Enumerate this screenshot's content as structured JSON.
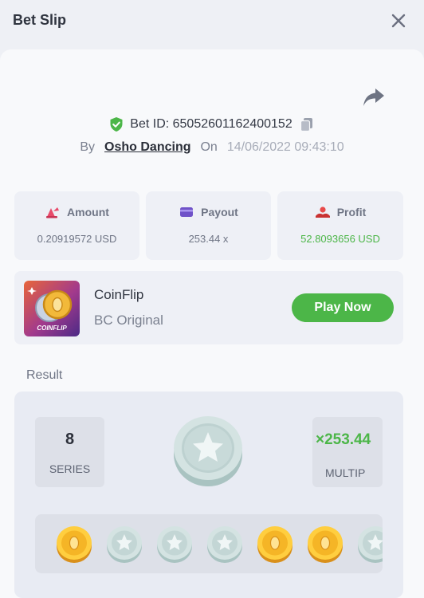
{
  "header": {
    "title": "Bet Slip"
  },
  "bet": {
    "id_label": "Bet ID: 65052601162400152",
    "by_label": "By",
    "user": "Osho Dancing",
    "on_label": "On",
    "date": "14/06/2022 09:43:10"
  },
  "stats": [
    {
      "label": "Amount",
      "value": "0.20919572 USD",
      "icon": "amount-icon"
    },
    {
      "label": "Payout",
      "value": "253.44 x",
      "icon": "wallet-icon"
    },
    {
      "label": "Profit",
      "value": "52.8093656 USD",
      "icon": "profit-icon"
    }
  ],
  "game": {
    "name": "CoinFlip",
    "provider": "BC Original",
    "thumb_text": "COINFLIP",
    "play_label": "Play Now"
  },
  "result": {
    "label": "Result",
    "series_value": "8",
    "series_label": "SERIES",
    "multiplier": "×253.44",
    "multiplier_label": "MULTIP",
    "coins": [
      "gold",
      "silver",
      "silver",
      "silver",
      "gold",
      "gold",
      "silver"
    ]
  },
  "colors": {
    "accent_green": "#4cb648",
    "panel_bg": "#f8f9fb",
    "card_bg": "#eef0f6"
  }
}
